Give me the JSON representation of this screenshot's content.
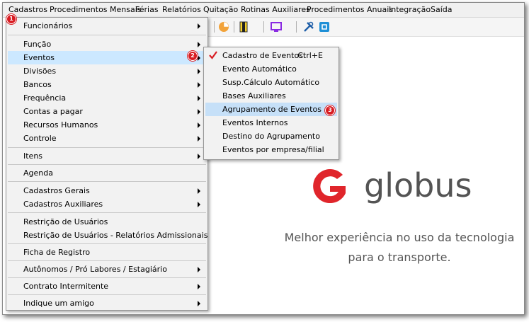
{
  "menubar": [
    "Cadastros",
    "Procedimentos Mensais",
    "Férias",
    "Relatórios",
    "Quitação",
    "Rotinas Auxiliares",
    "Procedimentos Anuais",
    "Integração",
    "Saída"
  ],
  "badges": [
    "1",
    "2",
    "3"
  ],
  "main_menu": {
    "items": [
      {
        "label": "Funcionários",
        "submenu": true
      },
      {
        "label": "Função",
        "submenu": true
      },
      {
        "label": "Eventos",
        "submenu": true
      },
      {
        "label": "Divisões",
        "submenu": true
      },
      {
        "label": "Bancos",
        "submenu": true
      },
      {
        "label": "Frequência",
        "submenu": true
      },
      {
        "label": "Contas a pagar",
        "submenu": true
      },
      {
        "label": "Recursos Humanos",
        "submenu": true
      },
      {
        "label": "Controle",
        "submenu": true
      },
      {
        "label": "Itens",
        "submenu": true
      },
      {
        "label": "Agenda",
        "submenu": false
      },
      {
        "label": "Cadastros Gerais",
        "submenu": true
      },
      {
        "label": "Cadastros Auxiliares",
        "submenu": true
      },
      {
        "label": "Restrição de Usuários",
        "submenu": false
      },
      {
        "label": "Restrição de Usuários - Relatórios Admissionais",
        "submenu": false
      },
      {
        "label": "Ficha de Registro",
        "submenu": false
      },
      {
        "label": "Autônomos / Pró Labores / Estagiário",
        "submenu": true
      },
      {
        "label": "Contrato Intermitente",
        "submenu": true
      },
      {
        "label": "Indique um amigo",
        "submenu": true
      }
    ]
  },
  "eventos_submenu": {
    "items": [
      {
        "label": "Cadastro de Eventos",
        "shortcut": "Ctrl+E"
      },
      {
        "label": "Evento Automático",
        "shortcut": ""
      },
      {
        "label": "Susp.Cálculo Automático",
        "shortcut": ""
      },
      {
        "label": "Bases Auxiliares",
        "shortcut": ""
      },
      {
        "label": "Agrupamento de Eventos",
        "shortcut": ""
      },
      {
        "label": "Eventos Internos",
        "shortcut": ""
      },
      {
        "label": "Destino do Agrupamento",
        "shortcut": ""
      },
      {
        "label": "Eventos por empresa/filial",
        "shortcut": ""
      }
    ]
  },
  "brand": {
    "name": "globus",
    "tagline_line1": "Melhor experiência no uso da tecnologia",
    "tagline_line2": "para o transporte.",
    "logo_color": "#e0252b",
    "text_color": "#545454"
  },
  "colors": {
    "selection": "#cce8ff",
    "checkmark": "#d81c22",
    "badge": "#d81c22"
  },
  "toolbar_icons": [
    "pie-chart-icon",
    "document-icon",
    "monitor-icon",
    "tools-icon",
    "app-icon"
  ]
}
